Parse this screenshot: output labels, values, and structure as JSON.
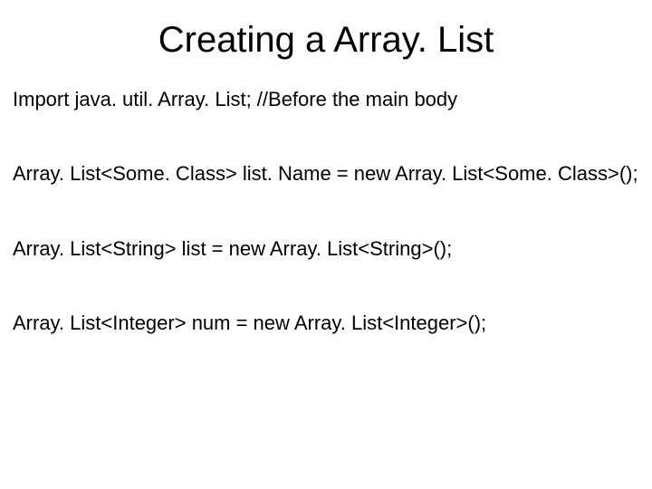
{
  "title": "Creating a Array. List",
  "lines": [
    "Import java. util. Array. List; //Before the main body",
    "Array. List<Some. Class> list. Name = new Array. List<Some. Class>();",
    "Array. List<String> list = new Array. List<String>();",
    "Array. List<Integer> num = new Array. List<Integer>();"
  ]
}
